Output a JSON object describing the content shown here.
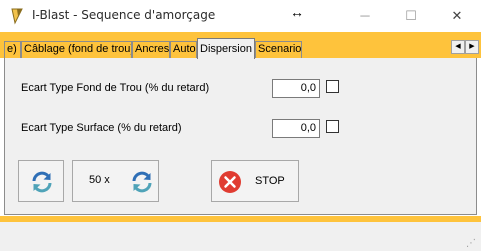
{
  "window": {
    "title": "I-Blast - Sequence d'amorçage",
    "move_glyph": "↔",
    "min_glyph": "─",
    "max_glyph": "☐",
    "close_glyph": "✕"
  },
  "tabs": [
    {
      "label": "e)"
    },
    {
      "label": "Câblage (fond de trou)"
    },
    {
      "label": "Ancres"
    },
    {
      "label": "Auto"
    },
    {
      "label": "Dispersion",
      "active": true
    },
    {
      "label": "Scenario"
    }
  ],
  "tab_scroll": {
    "left_glyph": "◀",
    "right_glyph": "▶"
  },
  "form": {
    "fond_label": "Ecart Type Fond de Trou (% du retard)",
    "fond_value": "0,0",
    "surface_label": "Ecart Type Surface (% du retard)",
    "surface_value": "0,0"
  },
  "buttons": {
    "refresh_icon": "refresh-icon",
    "multi_label": "50 x",
    "multi_icon": "refresh-icon",
    "stop_label": "STOP",
    "stop_icon": "stop-x-icon"
  },
  "status": {
    "grip_glyph": "⋰"
  },
  "colors": {
    "accent": "#fec33c",
    "panel": "#f0f0f0",
    "refresh_blue": "#2f6fb6",
    "refresh_teal": "#4fa3b8",
    "stop_red": "#e03c31"
  }
}
